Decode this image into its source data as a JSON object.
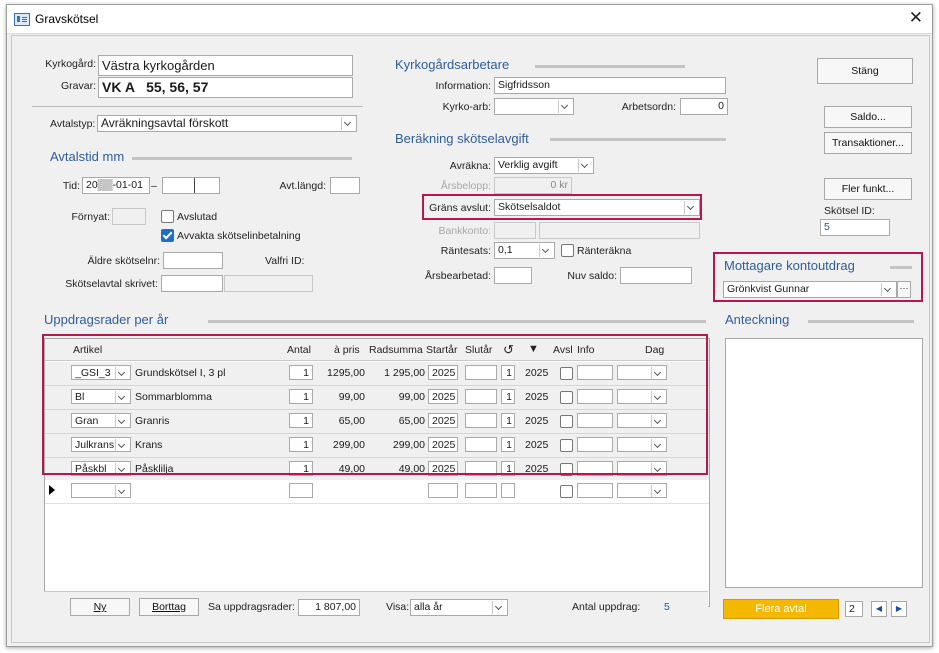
{
  "window": {
    "title": "Gravskötsel"
  },
  "top": {
    "kyrkogard_label": "Kyrkogård:",
    "kyrkogard_value": "Västra kyrkogården",
    "gravar_label": "Gravar:",
    "gravar_value": "VK A   55, 56, 57",
    "avtalstyp_label": "Avtalstyp:",
    "avtalstyp_value": "Avräkningsavtal förskott"
  },
  "avtalstid": {
    "section_title": "Avtalstid mm",
    "tid_label": "Tid:",
    "tid_from": "20▒▒-01-01",
    "tid_dash": "–",
    "tid_to": "",
    "avtlangd_label": "Avt.längd:",
    "avtlangd_value": "",
    "fornyat_label": "Förnyat:",
    "avslutad_label": "Avslutad",
    "avvakta_label": "Avvakta skötselinbetalning",
    "aldre_label": "Äldre skötselnr:",
    "valfri_label": "Valfri ID:",
    "skrivet_label": "Skötselavtal skrivet:"
  },
  "arbetare": {
    "section_title": "Kyrkogårdsarbetare",
    "information_label": "Information:",
    "information_value": "Sigfridsson",
    "kyrkoarb_label": "Kyrko-arb:",
    "arbetsordn_label": "Arbetsordn:",
    "arbetsordn_value": "0"
  },
  "berakning": {
    "section_title": "Beräkning skötselavgift",
    "avrakna_label": "Avräkna:",
    "avrakna_value": "Verklig avgift",
    "arsbelopp_label": "Årsbelopp:",
    "arsbelopp_value": "0 kr",
    "grans_label": "Gräns avslut:",
    "grans_value": "Skötselsaldot",
    "bankkonto_label": "Bankkonto:",
    "rantesats_label": "Räntesats:",
    "rantesats_value": "0,1",
    "rantrakna_label": "Ränteräkna",
    "arsbearbetad_label": "Årsbearbetad:",
    "nuvsaldo_label": "Nuv saldo:"
  },
  "buttons": {
    "stang": "Stäng",
    "saldo": "Saldo...",
    "transaktioner": "Transaktioner...",
    "fler": "Fler funkt...",
    "skotsel_id_label": "Skötsel ID:",
    "skotsel_id_value": "5"
  },
  "mottagare": {
    "section_title": "Mottagare kontoutdrag",
    "value": "Grönkvist Gunnar",
    "more": "···"
  },
  "anteckning": {
    "section_title": "Anteckning"
  },
  "uppdrag": {
    "section_title": "Uppdragsrader per år",
    "headers": {
      "artikel": "Artikel",
      "antal": "Antal",
      "apris": "à pris",
      "radsumma": "Radsumma",
      "startar": "Startår",
      "slutar": "Slutår",
      "reload": "↺",
      "arrow": "▼",
      "avsl": "Avsl",
      "info": "Info",
      "dag": "Dag"
    },
    "rows": [
      {
        "code": "_GSI_3",
        "name": "Grundskötsel I, 3 pl",
        "antal": "1",
        "apris": "1295,00",
        "radsumma": "1 295,00",
        "start": "2025",
        "slut": "",
        "n": "1",
        "year": "2025"
      },
      {
        "code": "Bl",
        "name": "Sommarblomma",
        "antal": "1",
        "apris": "99,00",
        "radsumma": "99,00",
        "start": "2025",
        "slut": "",
        "n": "1",
        "year": "2025"
      },
      {
        "code": "Gran",
        "name": "Granris",
        "antal": "1",
        "apris": "65,00",
        "radsumma": "65,00",
        "start": "2025",
        "slut": "",
        "n": "1",
        "year": "2025"
      },
      {
        "code": "Julkrans",
        "name": "Krans",
        "antal": "1",
        "apris": "299,00",
        "radsumma": "299,00",
        "start": "2025",
        "slut": "",
        "n": "1",
        "year": "2025"
      },
      {
        "code": "Påskbl",
        "name": "Påsklilja",
        "antal": "1",
        "apris": "49,00",
        "radsumma": "49,00",
        "start": "2025",
        "slut": "",
        "n": "1",
        "year": "2025"
      }
    ],
    "footer": {
      "ny": "Ny",
      "borttag": "Borttag",
      "sa_label": "Sa uppdragsrader:",
      "sa_value": "1 807,00",
      "visa_label": "Visa:",
      "visa_value": "alla år",
      "antal_label": "Antal uppdrag:",
      "antal_value": "5"
    }
  },
  "bottom_right": {
    "flera": "Flera avtal",
    "count": "2",
    "prev": "◀",
    "next": "▶"
  },
  "colors": {
    "accent_blue": "#2e5d9b",
    "highlight_red": "#b5174f",
    "flera_yellow": "#f5b800"
  }
}
